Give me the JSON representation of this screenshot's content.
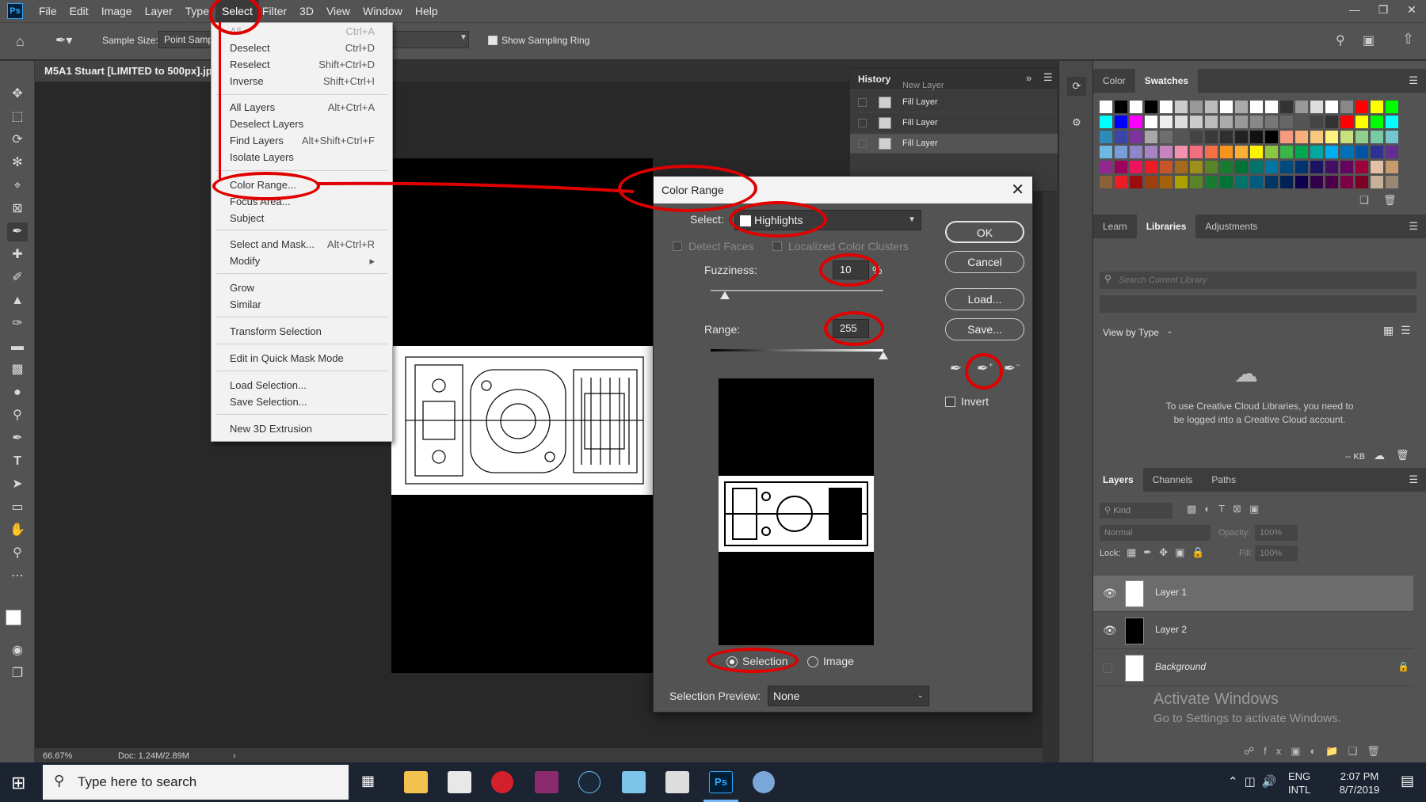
{
  "app": {
    "logo": "Ps",
    "menu": [
      "File",
      "Edit",
      "Image",
      "Layer",
      "Type",
      "Select",
      "Filter",
      "3D",
      "View",
      "Window",
      "Help"
    ],
    "window_controls": [
      "minimize-icon",
      "restore-icon",
      "close-icon"
    ]
  },
  "options_bar": {
    "sample_size_label": "Sample Size:",
    "sample_size_value": "Point Sample",
    "show_sampling_ring": "Show Sampling Ring"
  },
  "document": {
    "tab_title": "M5A1 Stuart [LIMITED to 500px].jpg",
    "zoom": "66.67%",
    "doc_size": "Doc: 1.24M/2.89M"
  },
  "select_menu": {
    "items": [
      {
        "label": "All",
        "shortcut": "Ctrl+A",
        "dim": true
      },
      {
        "label": "Deselect",
        "shortcut": "Ctrl+D"
      },
      {
        "label": "Reselect",
        "shortcut": "Shift+Ctrl+D"
      },
      {
        "label": "Inverse",
        "shortcut": "Shift+Ctrl+I"
      },
      {
        "label": "All Layers",
        "shortcut": "Alt+Ctrl+A"
      },
      {
        "label": "Deselect Layers",
        "shortcut": ""
      },
      {
        "label": "Find Layers",
        "shortcut": "Alt+Shift+Ctrl+F"
      },
      {
        "label": "Isolate Layers",
        "shortcut": ""
      },
      {
        "label": "Color Range...",
        "shortcut": ""
      },
      {
        "label": "Focus Area...",
        "shortcut": ""
      },
      {
        "label": "Subject",
        "shortcut": ""
      },
      {
        "label": "Select and Mask...",
        "shortcut": "Alt+Ctrl+R"
      },
      {
        "label": "Modify",
        "shortcut": ""
      },
      {
        "label": "Grow",
        "shortcut": ""
      },
      {
        "label": "Similar",
        "shortcut": ""
      },
      {
        "label": "Transform Selection",
        "shortcut": ""
      },
      {
        "label": "Edit in Quick Mask Mode",
        "shortcut": ""
      },
      {
        "label": "Load Selection...",
        "shortcut": ""
      },
      {
        "label": "Save Selection...",
        "shortcut": ""
      },
      {
        "label": "New 3D Extrusion",
        "shortcut": ""
      }
    ]
  },
  "history": {
    "title": "History",
    "rows": [
      "New Layer",
      "Fill Layer",
      "Fill Layer",
      "Fill Layer"
    ]
  },
  "color_range": {
    "title": "Color Range",
    "select_label": "Select:",
    "select_value": "Highlights",
    "detect_faces": "Detect Faces",
    "localized_clusters": "Localized Color Clusters",
    "fuzziness_label": "Fuzziness:",
    "fuzziness_value": "10",
    "fuzziness_unit": "%",
    "range_label": "Range:",
    "range_value": "255",
    "buttons": {
      "ok": "OK",
      "cancel": "Cancel",
      "load": "Load...",
      "save": "Save..."
    },
    "invert": "Invert",
    "selection": "Selection",
    "image": "Image",
    "selection_preview_label": "Selection Preview:",
    "selection_preview_value": "None"
  },
  "right_panels": {
    "color_tabs": [
      "Color",
      "Swatches"
    ],
    "swatch_colors": [
      "#ffffff",
      "#000000",
      "#ffffff",
      "#000000",
      "#ffffff",
      "#cccccc",
      "#999999",
      "#bbbbbb",
      "#ffffff",
      "#aaaaaa",
      "#ffffff",
      "#ffffff",
      "#333333",
      "#999999",
      "#dddddd",
      "#ffffff",
      "#888888",
      "#ff0000",
      "#ffff00",
      "#00ff00",
      "#00ffff",
      "#0000ff",
      "#ff00ff",
      "#ffffff",
      "#eeeeee",
      "#dddddd",
      "#cccccc",
      "#bbbbbb",
      "#aaaaaa",
      "#999999",
      "#888888",
      "#777777",
      "#666666",
      "#555555",
      "#444444",
      "#333333",
      "#ff0000",
      "#ffff00",
      "#00ff00",
      "#00ffff",
      "#2e8ab8",
      "#3b44a8",
      "#7e34a0",
      "#a8a8a8",
      "#6e6e6e",
      "#555555",
      "#444444",
      "#3a3a3a",
      "#2f2f2f",
      "#222222",
      "#111111",
      "#000000",
      "#f79b80",
      "#f7b07a",
      "#f9c87c",
      "#fff27c",
      "#c9e07e",
      "#8fd18c",
      "#78c9a6",
      "#74c6cf",
      "#6fb7e4",
      "#7a9ddb",
      "#8d86c9",
      "#a684c2",
      "#c684c0",
      "#f48fb1",
      "#f26d7d",
      "#f36f45",
      "#f7941d",
      "#fbaf34",
      "#fff200",
      "#8dc63f",
      "#39b54a",
      "#00a651",
      "#00a99d",
      "#00aeef",
      "#0072bc",
      "#0054a6",
      "#2e3192",
      "#662d91",
      "#92278f",
      "#9e005d",
      "#ed145b",
      "#ed1c24",
      "#c6562a",
      "#a66a1c",
      "#9e8e1a",
      "#598527",
      "#197b30",
      "#007236",
      "#00746b",
      "#0076a3",
      "#004a80",
      "#003471",
      "#1b1464",
      "#440e62",
      "#630460",
      "#9e0039",
      "#e3c0a6",
      "#c69c6d",
      "#8c6239",
      "#ed1c24",
      "#9e0b0f",
      "#a0410d",
      "#a36209",
      "#aba000",
      "#598527",
      "#197b30",
      "#007236",
      "#00746b",
      "#005b7f",
      "#003663",
      "#002157",
      "#0d004c",
      "#32004b",
      "#4b0049",
      "#7b0046",
      "#7a0026",
      "#c7b299",
      "#998675"
    ],
    "lib_tabs": [
      "Learn",
      "Libraries",
      "Adjustments"
    ],
    "lib_search_placeholder": "Search Current Library",
    "view_by": "View by Type",
    "lib_message": "To use Creative Cloud Libraries, you need to be logged into a Creative Cloud account.",
    "lib_size": "-- KB",
    "layer_tabs": [
      "Layers",
      "Channels",
      "Paths"
    ],
    "kind": "Kind",
    "blend_mode": "Normal",
    "opacity_label": "Opacity:",
    "opacity_value": "100%",
    "lock_label": "Lock:",
    "fill_label": "Fill:",
    "fill_value": "100%",
    "layers": [
      {
        "name": "Layer 1",
        "visible": true,
        "selected": true
      },
      {
        "name": "Layer 2",
        "visible": true,
        "selected": false
      },
      {
        "name": "Background",
        "visible": false,
        "selected": false,
        "locked": true
      }
    ],
    "activate_title": "Activate Windows",
    "activate_sub": "Go to Settings to activate Windows."
  },
  "taskbar": {
    "search_placeholder": "Type here to search",
    "lang1": "ENG",
    "lang2": "INTL",
    "time": "2:07 PM",
    "date": "8/7/2019"
  },
  "colors": {
    "annotation_red": "#e00000",
    "panel_bg": "#535353",
    "canvas_bg": "#282828",
    "taskbar_bg": "#1c2431"
  }
}
